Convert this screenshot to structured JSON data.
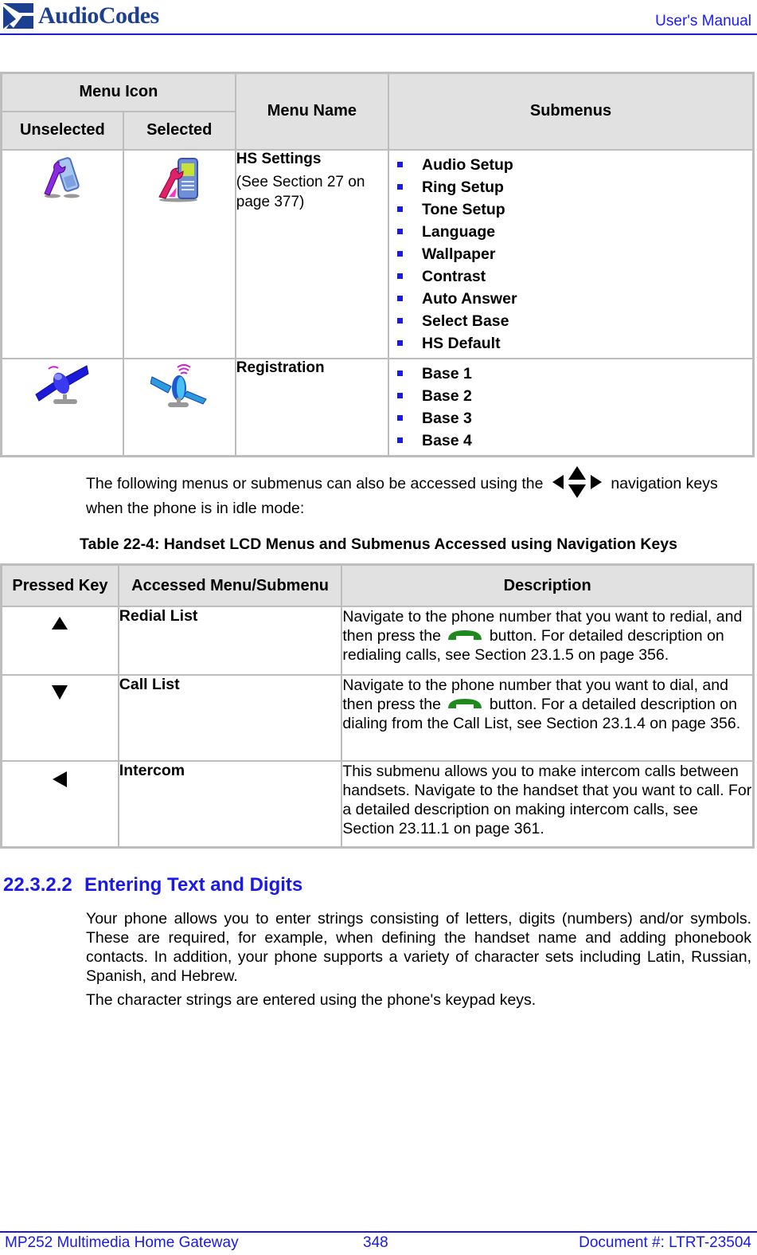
{
  "header": {
    "logo_text": "AudioCodes",
    "right_label": "User's Manual",
    "accent_color": "#1a1ae6"
  },
  "table1": {
    "headers": {
      "menu_icon": "Menu Icon",
      "unselected": "Unselected",
      "selected": "Selected",
      "menu_name": "Menu Name",
      "submenus": "Submenus"
    },
    "rows": [
      {
        "icon_unselected": "hs-settings-unselected-icon",
        "icon_selected": "hs-settings-selected-icon",
        "menu_name": "HS Settings",
        "reference": "(See Section 27 on page 377)",
        "submenus": [
          "Audio Setup",
          "Ring Setup",
          "Tone Setup",
          "Language",
          "Wallpaper",
          "Contrast",
          "Auto Answer",
          "Select Base",
          "HS Default"
        ]
      },
      {
        "icon_unselected": "registration-unselected-icon",
        "icon_selected": "registration-selected-icon",
        "menu_name": "Registration",
        "reference": "",
        "submenus": [
          "Base 1",
          "Base 2",
          "Base 3",
          "Base 4"
        ]
      }
    ]
  },
  "intro_paragraph": {
    "before_icon": "The following menus or submenus can also be accessed using the",
    "after_icon": "navigation keys when the phone is in idle mode:",
    "icon": "navigation-keys-icon"
  },
  "table2": {
    "caption": "Table 22-4: Handset LCD Menus and Submenus Accessed using Navigation Keys",
    "headers": {
      "pressed_key": "Pressed Key",
      "accessed_menu": "Accessed Menu/Submenu",
      "description": "Description"
    },
    "rows": [
      {
        "key_icon": "arrow-up-icon",
        "menu": "Redial List",
        "desc_before": "Navigate to the phone number that you want to redial, and then press the",
        "desc_after": "button. For detailed description on redialing calls, see Section 23.1.5 on page 356."
      },
      {
        "key_icon": "arrow-down-icon",
        "menu": "Call List",
        "desc_before": "Navigate to the phone number that you want to dial, and then press the",
        "desc_after": "button. For a detailed description on dialing from the Call List, see Section 23.1.4 on page 356."
      },
      {
        "key_icon": "arrow-left-icon",
        "menu": "Intercom",
        "desc_before": "This submenu allows you to make intercom calls between handsets. Navigate to the handset that you want to call. For a detailed description on making intercom calls, see Section 23.11.1 on page 361.",
        "desc_after": ""
      }
    ]
  },
  "section": {
    "number": "22.3.2.2",
    "title": "Entering Text and Digits",
    "paragraphs": [
      "Your phone allows you to enter strings consisting of letters, digits (numbers) and/or symbols. These are required, for example, when defining the handset name and adding phonebook contacts. In addition, your phone supports a variety of character sets including Latin, Russian, Spanish, and Hebrew.",
      "The character strings are entered using the phone's keypad keys."
    ]
  },
  "footer": {
    "product": "MP252 Multimedia Home Gateway",
    "page": "348",
    "document": "Document #: LTRT-23504"
  }
}
